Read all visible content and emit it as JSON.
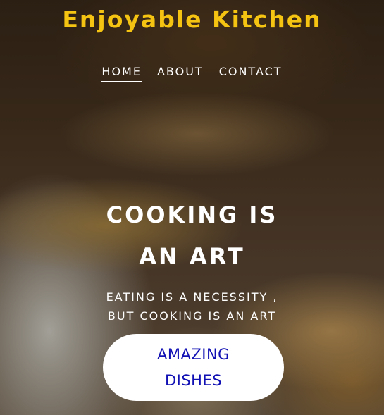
{
  "header": {
    "brand": "Enjoyable Kitchen"
  },
  "nav": {
    "items": [
      {
        "label": "HOME",
        "active": true
      },
      {
        "label": "ABOUT",
        "active": false
      },
      {
        "label": "CONTACT",
        "active": false
      }
    ]
  },
  "hero": {
    "headline_line1": "COOKING IS",
    "headline_line2": "AN ART",
    "subtitle_line1": "EATING IS A NECESSITY ,",
    "subtitle_line2": "BUT COOKING IS AN ART",
    "cta_label": "AMAZING DISHES"
  },
  "colors": {
    "brand": "#f5c311",
    "cta_text": "#1010b4",
    "cta_background": "#ffffff"
  }
}
